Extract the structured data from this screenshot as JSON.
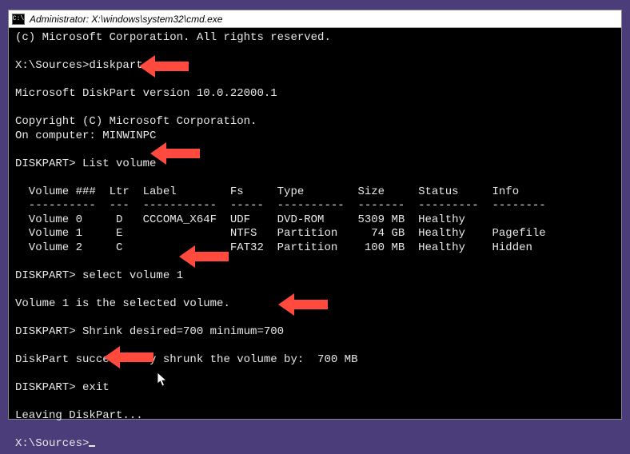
{
  "titlebar": {
    "icon_label": "C:\\",
    "title": "Administrator: X:\\windows\\system32\\cmd.exe"
  },
  "lines": {
    "copyright_ms": "(c) Microsoft Corporation. All rights reserved.",
    "blank": "",
    "prompt1": "X:\\Sources>diskpart",
    "dp_version": "Microsoft DiskPart version 10.0.22000.1",
    "dp_copyright": "Copyright (C) Microsoft Corporation.",
    "on_computer": "On computer: MINWINPC",
    "prompt2": "DISKPART> List volume",
    "tbl_header": "  Volume ###  Ltr  Label        Fs     Type        Size     Status     Info",
    "tbl_divider": "  ----------  ---  -----------  -----  ----------  -------  ---------  --------",
    "tbl_row0": "  Volume 0     D   CCCOMA_X64F  UDF    DVD-ROM     5309 MB  Healthy",
    "tbl_row1": "  Volume 1     E                NTFS   Partition     74 GB  Healthy    Pagefile",
    "tbl_row2": "  Volume 2     C                FAT32  Partition    100 MB  Healthy    Hidden",
    "prompt3": "DISKPART> select volume 1",
    "selected_msg": "Volume 1 is the selected volume.",
    "prompt4": "DISKPART> Shrink desired=700 minimum=700",
    "shrink_msg": "DiskPart successfully shrunk the volume by:  700 MB",
    "prompt5": "DISKPART> exit",
    "leaving": "Leaving DiskPart...",
    "prompt6": "X:\\Sources>"
  },
  "annotations": {
    "arrow_color": "#ff4a3d"
  }
}
